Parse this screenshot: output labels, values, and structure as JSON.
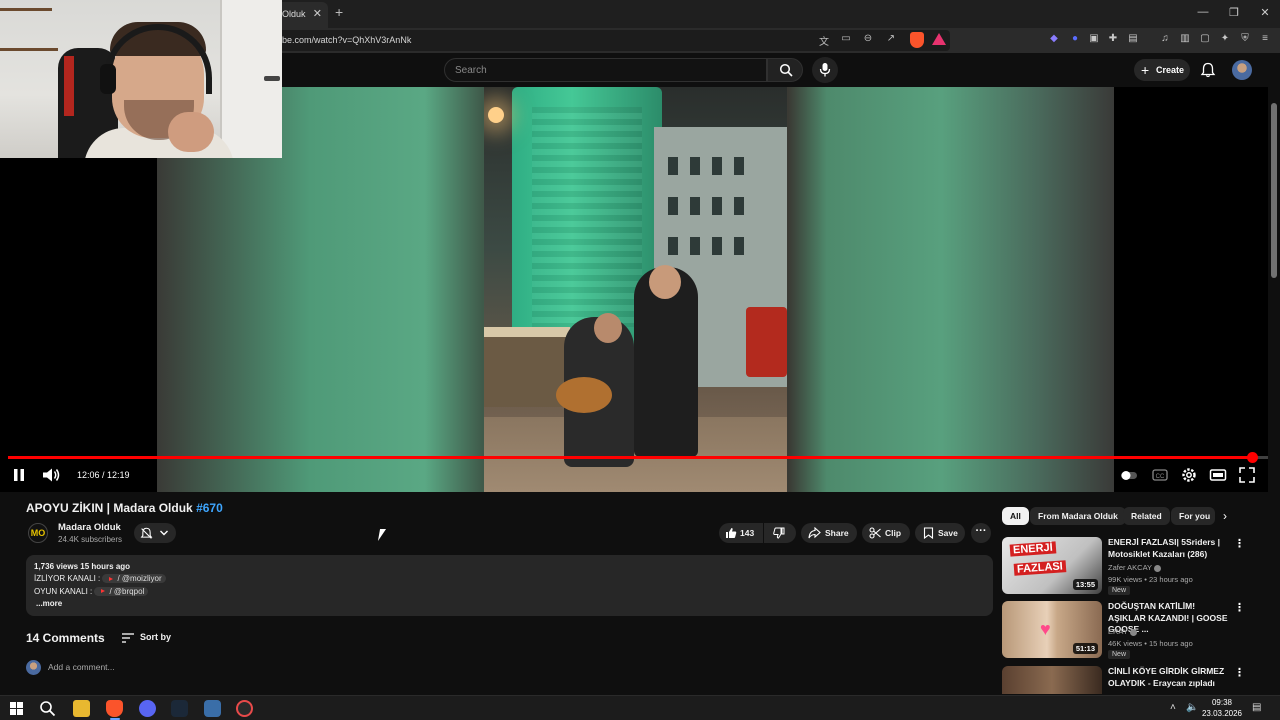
{
  "browser": {
    "tab_title": "Olduk",
    "tab_close": "✕",
    "new_tab": "+",
    "url": "be.com/watch?v=QhXhV3rAnNk",
    "window_minimize": "—",
    "window_restore": "❐",
    "window_close": "✕"
  },
  "masthead": {
    "search_placeholder": "Search",
    "create_label": "Create",
    "create_plus": "+"
  },
  "player": {
    "time": "12:06 / 12:19",
    "progress": 0.984
  },
  "video": {
    "title_main": "APOYU ZİKIN | Madara Olduk",
    "title_tag": "#670",
    "channel_name": "Madara Olduk",
    "channel_logo": "MO",
    "subscribers": "24.4K subscribers",
    "like_count": "143",
    "share_label": "Share",
    "clip_label": "Clip",
    "save_label": "Save",
    "more_label": "···"
  },
  "description": {
    "meta": "1,736 views  15 hours ago",
    "line1_label": "İZLİYOR KANALI :",
    "line1_handle": "/ @moizliyor",
    "line2_label": "OYUN KANALI :",
    "line2_handle": "/ @brqpol",
    "more": "...more"
  },
  "comments": {
    "count_label": "14 Comments",
    "sort_label": "Sort by",
    "add_placeholder": "Add a comment..."
  },
  "chips": [
    {
      "label": "All"
    },
    {
      "label": "From Madara Olduk"
    },
    {
      "label": "Related"
    },
    {
      "label": "For you"
    }
  ],
  "chips_next": "›",
  "recommendations": [
    {
      "title": "ENERJİ FAZLASI| 5Sriders | Motosiklet Kazaları (286)",
      "channel": "Zafer AKCAY",
      "meta": "99K views • 23 hours ago",
      "badge": "New",
      "duration": "13:55",
      "thumb_text_1": "ENERJİ",
      "thumb_text_2": "FAZLASI"
    },
    {
      "title": "DOĞUŞTAN KATİLİM! AŞIKLAR KAZANDI! | GOOSE GOOSE ...",
      "channel": "ERAY",
      "meta": "46K views • 15 hours ago",
      "badge": "New",
      "duration": "51:13"
    },
    {
      "title": "CİNLİ KÖYE GİRDİK GİRMEZ OLAYDIK - Eraycan zıpladı",
      "channel": "",
      "meta": "",
      "badge": "",
      "duration": ""
    }
  ],
  "taskbar": {
    "time": "09:38",
    "date": "23.03.2026"
  },
  "colors": {
    "accent": "#ff0000",
    "link": "#3ea6ff",
    "background": "#0f0f0f",
    "surface": "#272727"
  }
}
